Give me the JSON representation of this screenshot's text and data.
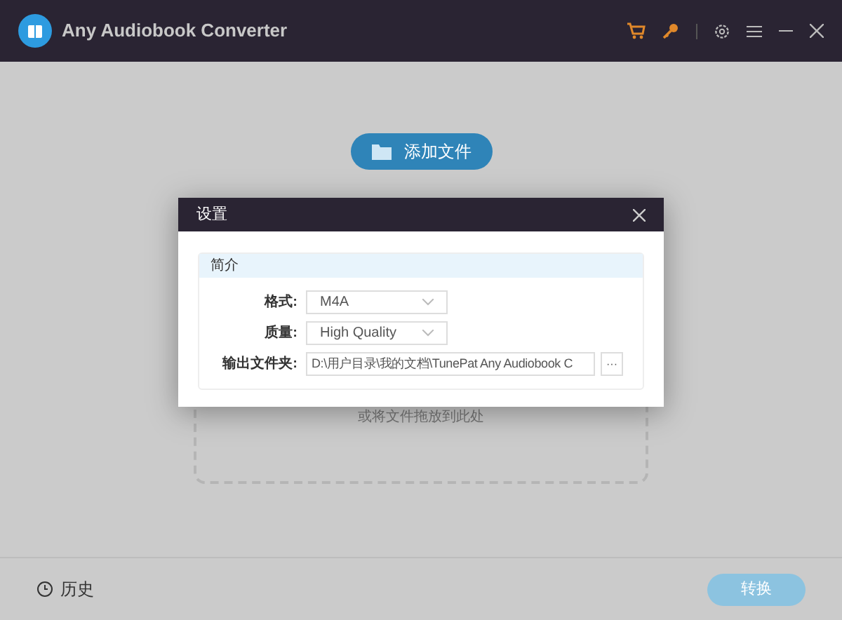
{
  "window": {
    "title": "Any Audiobook Converter"
  },
  "toolbar": [
    {
      "kind": "cart"
    },
    {
      "kind": "key"
    },
    {
      "kind": "settings"
    },
    {
      "kind": "menu"
    },
    {
      "kind": "minimize"
    },
    {
      "kind": "close"
    }
  ],
  "add_button": {
    "label": "添加文件"
  },
  "drop_zone": {
    "hint": "或将文件拖放到此处"
  },
  "history": {
    "label": "历史"
  },
  "convert_button": {
    "label": "转换",
    "disabled": true
  },
  "dialog": {
    "title": "设置",
    "section": "简介",
    "fields": [
      {
        "kind": "select",
        "label": "格式:",
        "value": "M4A"
      },
      {
        "kind": "select",
        "label": "质量:",
        "value": "High Quality"
      },
      {
        "kind": "path",
        "label": "输出文件夹:",
        "value": "D:\\用户目录\\我的文档\\TunePat Any Audiobook C",
        "button": "···"
      }
    ]
  }
}
